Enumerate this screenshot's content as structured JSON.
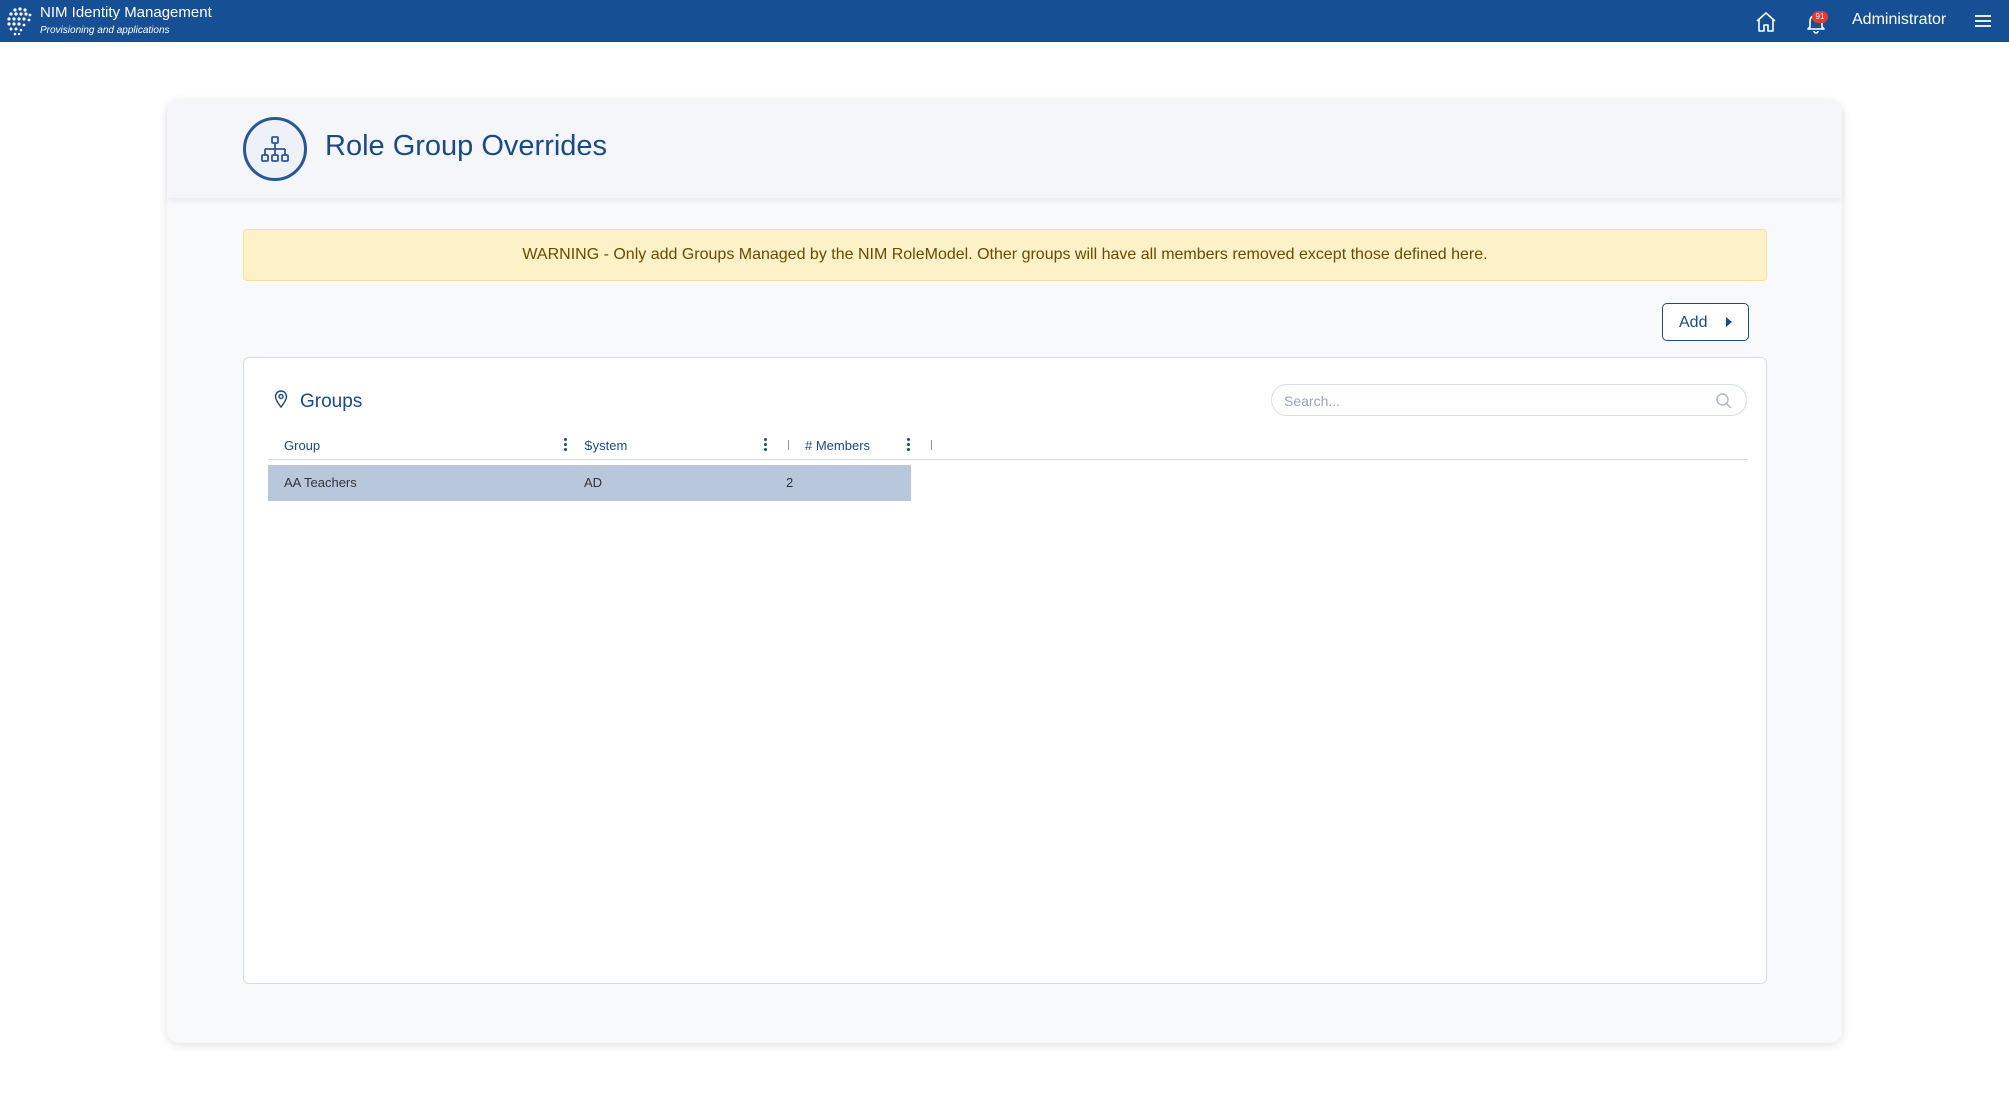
{
  "topbar": {
    "title": "NIM Identity Management",
    "subtitle": "Provisioning and applications",
    "notification_count": "91",
    "user": "Administrator",
    "icons": [
      "app-logo-icon",
      "home-icon",
      "bell-icon",
      "hamburger-menu-icon"
    ]
  },
  "page": {
    "title": "Role Group Overrides",
    "icon": "org-chart-icon"
  },
  "warning": {
    "text": "WARNING - Only add Groups Managed by the NIM RoleModel. Other groups will have all members removed except those defined here."
  },
  "actions": {
    "add_label": "Add"
  },
  "groups": {
    "title": "Groups",
    "icon": "map-pin-icon",
    "search_placeholder": "Search...",
    "columns": [
      {
        "label": "Group"
      },
      {
        "label": "System"
      },
      {
        "label": "# Members"
      }
    ],
    "rows": [
      {
        "group": "AA Teachers",
        "system": "AD",
        "members": "2"
      }
    ]
  },
  "colors": {
    "topbar": "#164f94",
    "accent": "#1a4a8a",
    "warning_bg": "#fdf1c8",
    "selected_row": "#b8c7dc"
  }
}
